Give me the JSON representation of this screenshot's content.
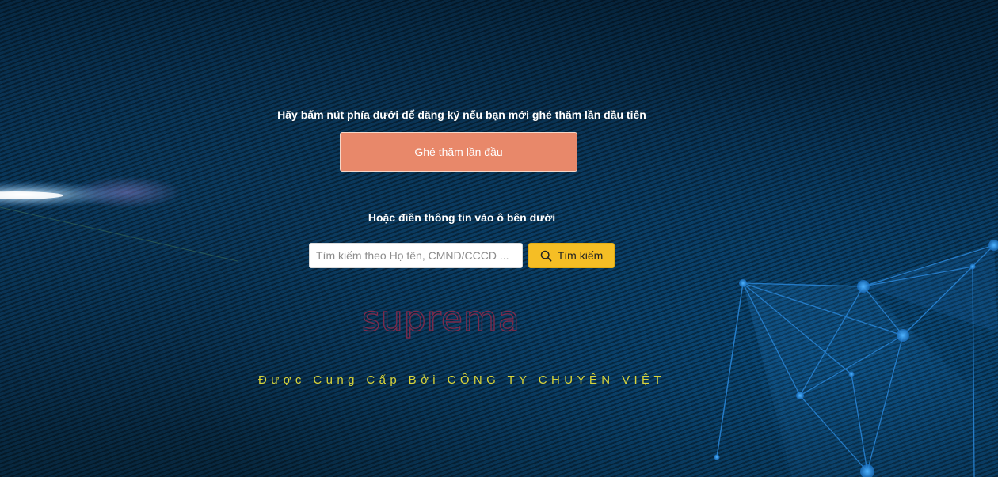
{
  "register": {
    "prompt": "Hãy bấm nút phía dưới để đăng ký nếu bạn mới ghé thăm lần đầu tiên",
    "button_label": "Ghé thăm lần đầu"
  },
  "search": {
    "prompt": "Hoặc điền thông tin vào ô bên dưới",
    "placeholder": "Tìm kiếm theo Họ tên, CMND/CCCD ...",
    "value": "",
    "button_label": "Tìm kiếm",
    "button_icon": "search-icon"
  },
  "branding": {
    "logo_text": "suprema",
    "provided_by": "Được Cung Cấp Bởi CÔNG TY CHUYÊN VIỆT"
  },
  "colors": {
    "register_button": "#e8886a",
    "search_button": "#f5be25",
    "provided_text": "#d9d43a",
    "logo": "#7a2b4c",
    "background": "#0a3253"
  }
}
